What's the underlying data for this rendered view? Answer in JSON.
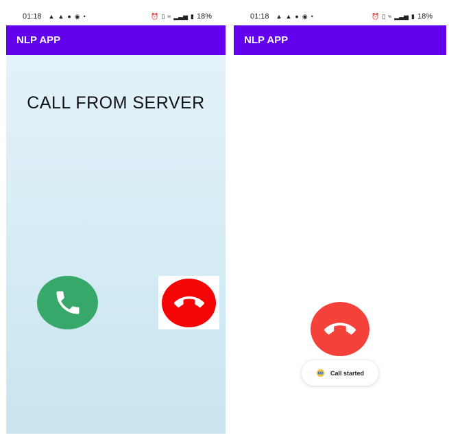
{
  "screens": [
    {
      "status_bar": {
        "time": "01:18",
        "battery": "18%"
      },
      "app_bar": {
        "title": "NLP APP"
      },
      "call_title": "CALL FROM SERVER",
      "accept_icon": "phone-icon",
      "decline_icon": "hangup-icon"
    },
    {
      "status_bar": {
        "time": "01:18",
        "battery": "18%"
      },
      "app_bar": {
        "title": "NLP APP"
      },
      "end_call_icon": "hangup-icon",
      "toast": {
        "text": "Call started",
        "icon": "app-logo-icon"
      }
    }
  ],
  "colors": {
    "app_bar": "#6200ee",
    "accept": "#37a869",
    "decline": "#f50505",
    "end_call": "#f4413a"
  }
}
